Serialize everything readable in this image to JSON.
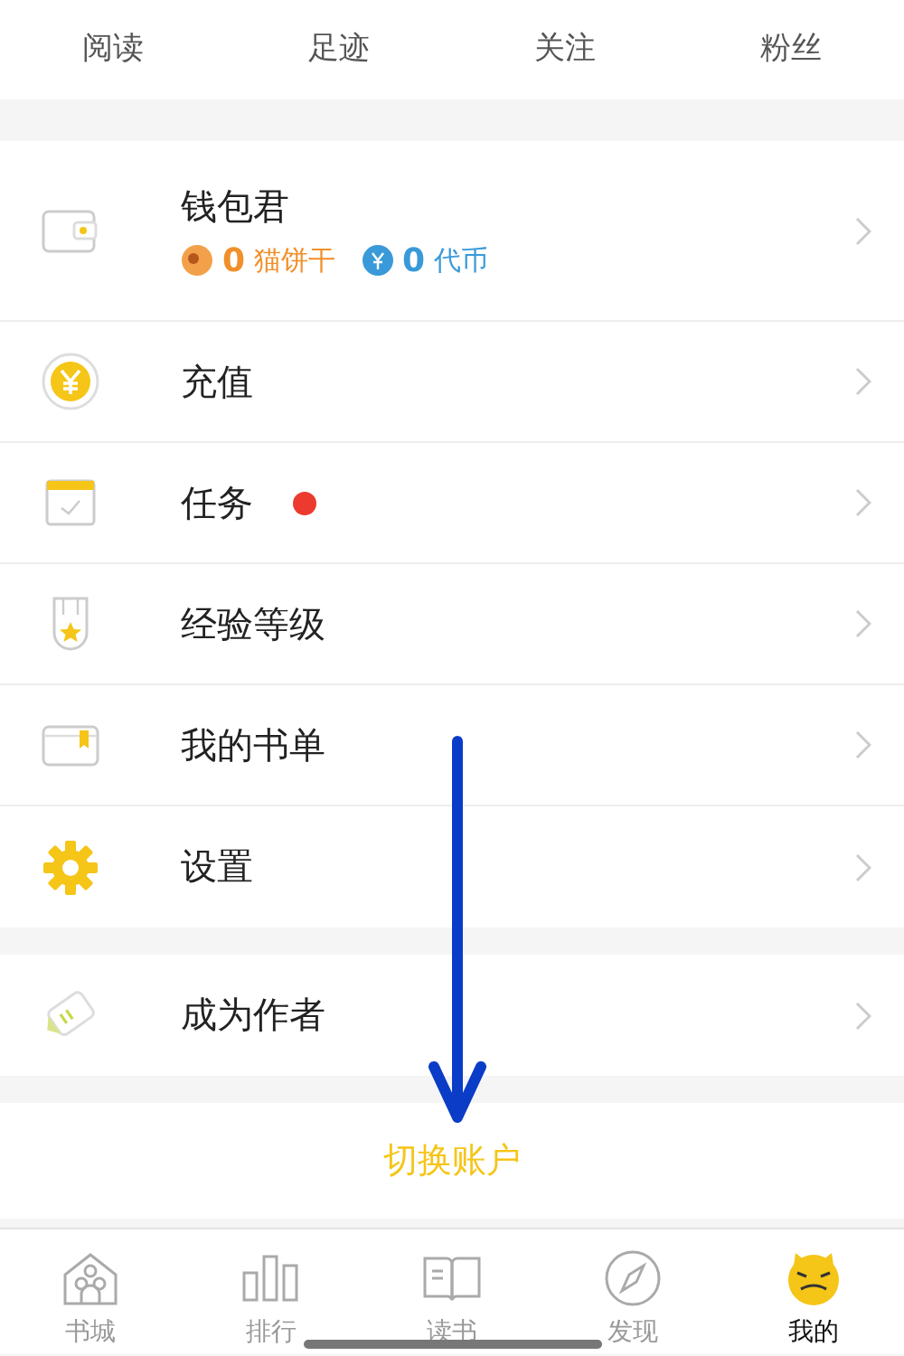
{
  "stats": [
    {
      "label": "阅读"
    },
    {
      "label": "足迹"
    },
    {
      "label": "关注"
    },
    {
      "label": "粉丝"
    }
  ],
  "groups": [
    {
      "items": [
        {
          "label": "钱包君",
          "has_dot": false,
          "balances": [
            {
              "amount": "0",
              "unit": "猫饼干",
              "color": "#f0902a"
            },
            {
              "amount": "0",
              "unit": "代币",
              "color": "#3a9ad9"
            }
          ]
        },
        {
          "label": "充值",
          "has_dot": false
        },
        {
          "label": "任务",
          "has_dot": true
        },
        {
          "label": "经验等级",
          "has_dot": false
        },
        {
          "label": "我的书单",
          "has_dot": false
        },
        {
          "label": "设置",
          "has_dot": false
        }
      ]
    },
    {
      "items": [
        {
          "label": "成为作者",
          "has_dot": false
        }
      ]
    }
  ],
  "switch_account": "切换账户",
  "tabs": [
    {
      "label": "书城",
      "selected": false
    },
    {
      "label": "排行",
      "selected": false
    },
    {
      "label": "读书",
      "selected": false
    },
    {
      "label": "发现",
      "selected": false
    },
    {
      "label": "我的",
      "selected": true
    }
  ]
}
